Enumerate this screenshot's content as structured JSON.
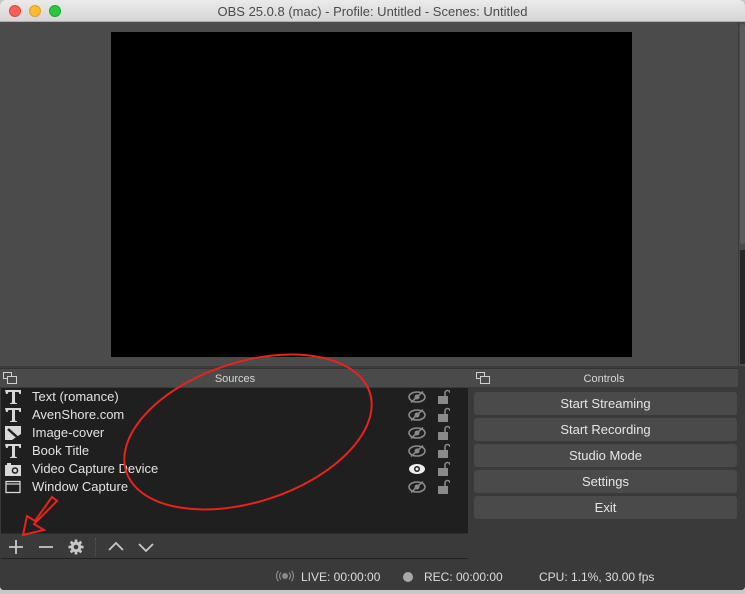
{
  "window": {
    "title": "OBS 25.0.8 (mac) - Profile: Untitled - Scenes: Untitled"
  },
  "sources_dock": {
    "title": "Sources",
    "items": [
      {
        "label": "Text (romance)",
        "type_icon": "text-icon",
        "visible": false,
        "locked": false
      },
      {
        "label": "AvenShore.com",
        "type_icon": "text-icon",
        "visible": false,
        "locked": false
      },
      {
        "label": "Image-cover",
        "type_icon": "image-icon",
        "visible": false,
        "locked": false
      },
      {
        "label": "Book Title",
        "type_icon": "text-icon",
        "visible": false,
        "locked": false
      },
      {
        "label": "Video Capture Device",
        "type_icon": "camera-icon",
        "visible": true,
        "locked": false
      },
      {
        "label": "Window Capture",
        "type_icon": "window-icon",
        "visible": false,
        "locked": false
      }
    ],
    "toolbar": {
      "add": "plus-icon",
      "remove": "minus-icon",
      "properties": "gear-icon",
      "move_up": "chevron-up-icon",
      "move_down": "chevron-down-icon"
    }
  },
  "controls_dock": {
    "title": "Controls",
    "buttons": [
      "Start Streaming",
      "Start Recording",
      "Studio Mode",
      "Settings",
      "Exit"
    ]
  },
  "status": {
    "live": "LIVE: 00:00:00",
    "rec": "REC: 00:00:00",
    "cpu": "CPU: 1.1%, 30.00 fps"
  },
  "annotations": {
    "color": "#e8231d",
    "shapes": [
      "ellipse-around-sources",
      "arrow-to-add-button"
    ]
  }
}
